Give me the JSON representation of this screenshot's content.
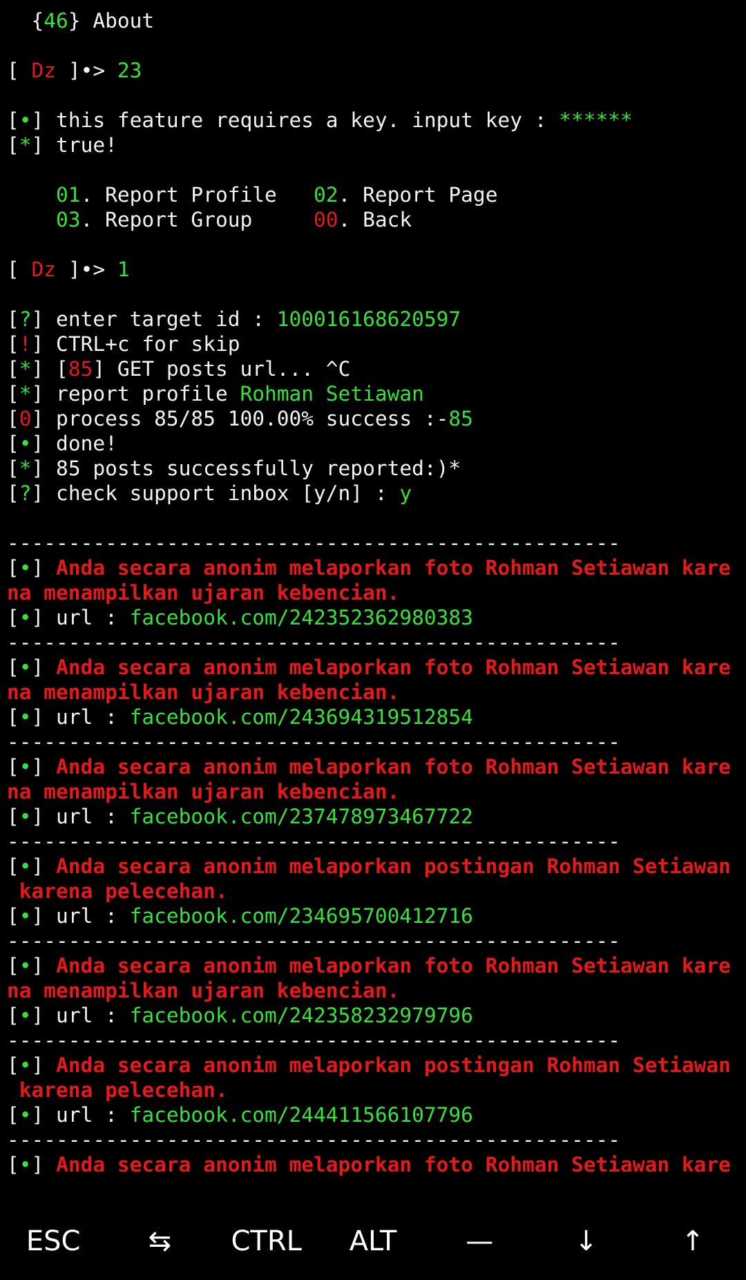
{
  "terminal": {
    "lines": [
      [
        [
          "w",
          "  {"
        ],
        [
          "g",
          "46"
        ],
        [
          "w",
          "} About"
        ]
      ],
      [],
      [
        [
          "w",
          "[ "
        ],
        [
          "r",
          "Dz"
        ],
        [
          "w",
          " ]•> "
        ],
        [
          "g",
          "23"
        ]
      ],
      [],
      [
        [
          "w",
          "["
        ],
        [
          "g",
          "•"
        ],
        [
          "w",
          "] this feature requires a key. input key : "
        ],
        [
          "g",
          "******"
        ]
      ],
      [
        [
          "w",
          "["
        ],
        [
          "g",
          "*"
        ],
        [
          "w",
          "] true!"
        ]
      ],
      [],
      [
        [
          "w",
          "    "
        ],
        [
          "g",
          "01"
        ],
        [
          "w",
          ". Report Profile   "
        ],
        [
          "g",
          "02"
        ],
        [
          "w",
          ". Report Page"
        ]
      ],
      [
        [
          "w",
          "    "
        ],
        [
          "g",
          "03"
        ],
        [
          "w",
          ". Report Group     "
        ],
        [
          "r",
          "00"
        ],
        [
          "w",
          ". Back"
        ]
      ],
      [],
      [
        [
          "w",
          "[ "
        ],
        [
          "r",
          "Dz"
        ],
        [
          "w",
          " ]•> "
        ],
        [
          "g",
          "1"
        ]
      ],
      [],
      [
        [
          "w",
          "["
        ],
        [
          "g",
          "?"
        ],
        [
          "w",
          "] enter target id : "
        ],
        [
          "g",
          "100016168620597"
        ]
      ],
      [
        [
          "w",
          "["
        ],
        [
          "r",
          "!"
        ],
        [
          "w",
          "] CTRL+c for skip"
        ]
      ],
      [
        [
          "w",
          "["
        ],
        [
          "g",
          "*"
        ],
        [
          "w",
          "] ["
        ],
        [
          "r",
          "85"
        ],
        [
          "w",
          "] GET posts url... ^C"
        ]
      ],
      [
        [
          "w",
          "["
        ],
        [
          "g",
          "*"
        ],
        [
          "w",
          "] report profile "
        ],
        [
          "g",
          "Rohman Setiawan"
        ]
      ],
      [
        [
          "w",
          "["
        ],
        [
          "r",
          "0"
        ],
        [
          "w",
          "] process 85/85 100.00% success :-"
        ],
        [
          "g",
          "85"
        ]
      ],
      [
        [
          "w",
          "["
        ],
        [
          "g",
          "•"
        ],
        [
          "w",
          "] done!"
        ]
      ],
      [
        [
          "w",
          "["
        ],
        [
          "g",
          "*"
        ],
        [
          "w",
          "] 85 posts successfully reported:)*"
        ]
      ],
      [
        [
          "w",
          "["
        ],
        [
          "g",
          "?"
        ],
        [
          "w",
          "] check support inbox [y/n] : "
        ],
        [
          "g",
          "y"
        ]
      ],
      [],
      [
        [
          "w",
          "--------------------------------------------------"
        ]
      ],
      [
        [
          "w",
          "["
        ],
        [
          "g",
          "•"
        ],
        [
          "w",
          "] "
        ],
        [
          "rb",
          "Anda secara anonim melaporkan foto Rohman Setiawan kare"
        ]
      ],
      [
        [
          "rb",
          "na menampilkan ujaran kebencian."
        ]
      ],
      [
        [
          "w",
          "["
        ],
        [
          "g",
          "•"
        ],
        [
          "w",
          "] url : "
        ],
        [
          "g",
          "facebook.com/242352362980383"
        ]
      ],
      [
        [
          "w",
          "--------------------------------------------------"
        ]
      ],
      [
        [
          "w",
          "["
        ],
        [
          "g",
          "•"
        ],
        [
          "w",
          "] "
        ],
        [
          "rb",
          "Anda secara anonim melaporkan foto Rohman Setiawan kare"
        ]
      ],
      [
        [
          "rb",
          "na menampilkan ujaran kebencian."
        ]
      ],
      [
        [
          "w",
          "["
        ],
        [
          "g",
          "•"
        ],
        [
          "w",
          "] url : "
        ],
        [
          "g",
          "facebook.com/243694319512854"
        ]
      ],
      [
        [
          "w",
          "--------------------------------------------------"
        ]
      ],
      [
        [
          "w",
          "["
        ],
        [
          "g",
          "•"
        ],
        [
          "w",
          "] "
        ],
        [
          "rb",
          "Anda secara anonim melaporkan foto Rohman Setiawan kare"
        ]
      ],
      [
        [
          "rb",
          "na menampilkan ujaran kebencian."
        ]
      ],
      [
        [
          "w",
          "["
        ],
        [
          "g",
          "•"
        ],
        [
          "w",
          "] url : "
        ],
        [
          "g",
          "facebook.com/237478973467722"
        ]
      ],
      [
        [
          "w",
          "--------------------------------------------------"
        ]
      ],
      [
        [
          "w",
          "["
        ],
        [
          "g",
          "•"
        ],
        [
          "w",
          "] "
        ],
        [
          "rb",
          "Anda secara anonim melaporkan postingan Rohman Setiawan"
        ]
      ],
      [
        [
          "rb",
          " karena pelecehan."
        ]
      ],
      [
        [
          "w",
          "["
        ],
        [
          "g",
          "•"
        ],
        [
          "w",
          "] url : "
        ],
        [
          "g",
          "facebook.com/234695700412716"
        ]
      ],
      [
        [
          "w",
          "--------------------------------------------------"
        ]
      ],
      [
        [
          "w",
          "["
        ],
        [
          "g",
          "•"
        ],
        [
          "w",
          "] "
        ],
        [
          "rb",
          "Anda secara anonim melaporkan foto Rohman Setiawan kare"
        ]
      ],
      [
        [
          "rb",
          "na menampilkan ujaran kebencian."
        ]
      ],
      [
        [
          "w",
          "["
        ],
        [
          "g",
          "•"
        ],
        [
          "w",
          "] url : "
        ],
        [
          "g",
          "facebook.com/242358232979796"
        ]
      ],
      [
        [
          "w",
          "--------------------------------------------------"
        ]
      ],
      [
        [
          "w",
          "["
        ],
        [
          "g",
          "•"
        ],
        [
          "w",
          "] "
        ],
        [
          "rb",
          "Anda secara anonim melaporkan postingan Rohman Setiawan"
        ]
      ],
      [
        [
          "rb",
          " karena pelecehan."
        ]
      ],
      [
        [
          "w",
          "["
        ],
        [
          "g",
          "•"
        ],
        [
          "w",
          "] url : "
        ],
        [
          "g",
          "facebook.com/244411566107796"
        ]
      ],
      [
        [
          "w",
          "--------------------------------------------------"
        ]
      ],
      [
        [
          "w",
          "["
        ],
        [
          "g",
          "•"
        ],
        [
          "w",
          "] "
        ],
        [
          "rb",
          "Anda secara anonim melaporkan foto Rohman Setiawan kare"
        ]
      ]
    ]
  },
  "extra_keys": [
    {
      "label": "ESC",
      "name": "esc-key"
    },
    {
      "label": "⇆",
      "name": "tab-key"
    },
    {
      "label": "CTRL",
      "name": "ctrl-key"
    },
    {
      "label": "ALT",
      "name": "alt-key"
    },
    {
      "label": "—",
      "name": "dash-key"
    },
    {
      "label": "↓",
      "name": "arrow-down-key"
    },
    {
      "label": "↑",
      "name": "arrow-up-key"
    }
  ],
  "colors": {
    "background": "#000000",
    "text": "#f2f2f2",
    "green": "#35e13a",
    "red": "#e5191c"
  }
}
